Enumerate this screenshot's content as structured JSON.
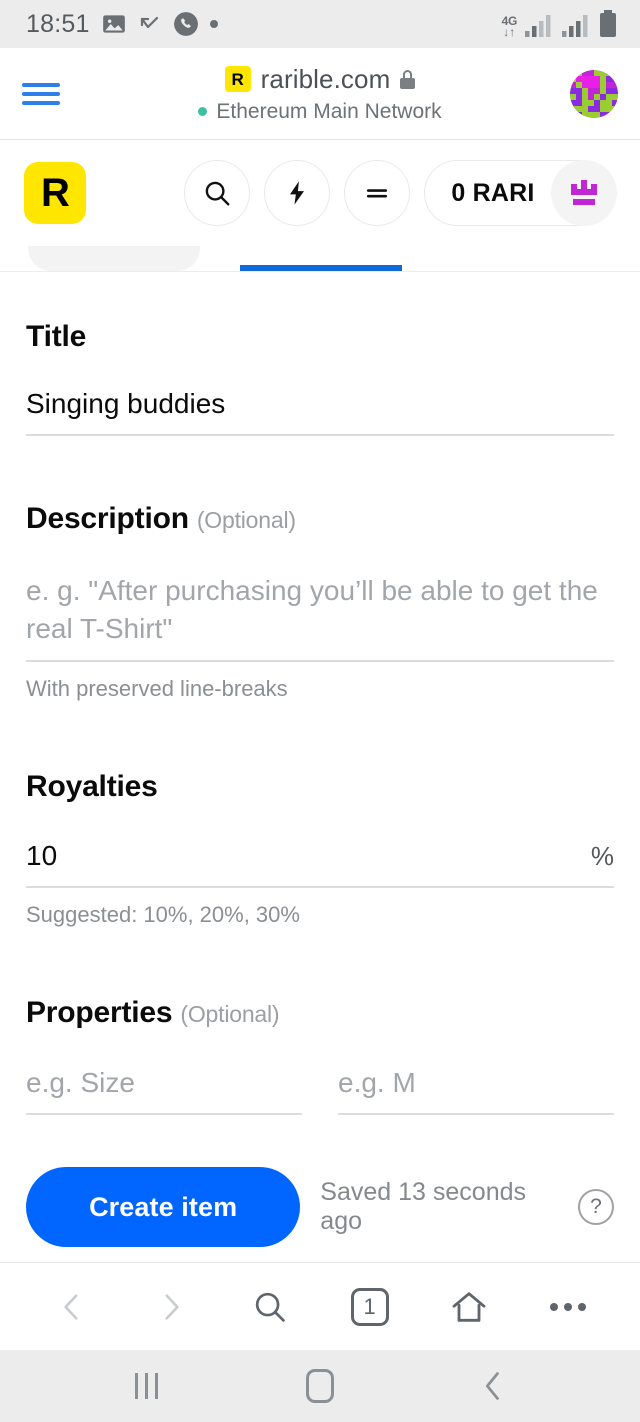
{
  "statusbar": {
    "time": "18:51",
    "left_icons": [
      "image-icon",
      "missed-call-icon",
      "phone-icon",
      "dot-icon"
    ],
    "network_type": "4G",
    "right_icons": [
      "signal-bars-1",
      "signal-bars-2",
      "battery-icon"
    ]
  },
  "browser": {
    "menu_icon": "hamburger-menu-icon",
    "favicon_letter": "R",
    "url": "rarible.com",
    "lock_icon": "lock-icon",
    "network_status": "Ethereum Main Network",
    "network_dot_color": "#3cc29e",
    "avatar": "user-avatar-identicon"
  },
  "appheader": {
    "logo_letter": "R",
    "logo_bg": "#ffe600",
    "buttons": [
      {
        "name": "search-button",
        "icon": "search-icon"
      },
      {
        "name": "activity-button",
        "icon": "lightning-bolt-icon"
      },
      {
        "name": "filter-button",
        "icon": "equals-lines-icon"
      }
    ],
    "token_balance": "0 RARI",
    "token_icon": "rari-crown-icon",
    "token_icon_color": "#c026d3"
  },
  "tabs": {
    "inactive_tab_name": "tab-inactive",
    "active_tab_name": "tab-active",
    "active_indicator_color": "#1169d9"
  },
  "form": {
    "title": {
      "label": "Title",
      "value": "Singing buddies"
    },
    "description": {
      "label": "Description",
      "optional": "(Optional)",
      "placeholder": "e. g. \"After purchasing you’ll be able to get the real T-Shirt\"",
      "hint": "With preserved line-breaks"
    },
    "royalties": {
      "label": "Royalties",
      "value": "10",
      "unit": "%",
      "hint": "Suggested: 10%, 20%, 30%"
    },
    "properties": {
      "label": "Properties",
      "optional": "(Optional)",
      "key_placeholder": "e.g. Size",
      "value_placeholder": "e.g. M"
    },
    "actions": {
      "create_label": "Create item",
      "create_color": "#0066ff",
      "saved_status": "Saved 13 seconds ago",
      "help_label": "?"
    }
  },
  "browserbar": {
    "items": [
      {
        "name": "back-button",
        "icon": "chevron-left-icon",
        "disabled": true
      },
      {
        "name": "forward-button",
        "icon": "chevron-right-icon",
        "disabled": true
      },
      {
        "name": "browser-search-button",
        "icon": "search-icon"
      },
      {
        "name": "tab-switcher-button",
        "icon": "tab-count-icon",
        "count": "1"
      },
      {
        "name": "browser-home-button",
        "icon": "home-icon"
      },
      {
        "name": "browser-more-button",
        "icon": "more-horizontal-icon"
      }
    ],
    "tab_count": "1"
  },
  "androidnav": {
    "recents_icon": "recents-icon",
    "home_icon": "home-square-icon",
    "back_icon": "back-chevron-icon"
  }
}
